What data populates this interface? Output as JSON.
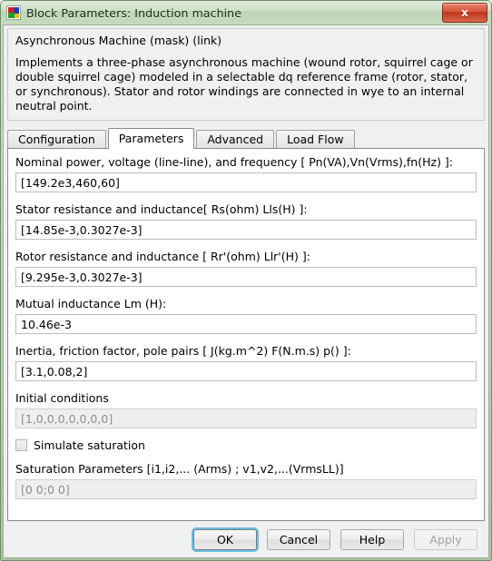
{
  "window": {
    "title": "Block Parameters: Induction machine",
    "icon": "simulink-block-icon",
    "close_label": "x",
    "frame_color": "#bcd4b4"
  },
  "description": {
    "heading": "Asynchronous Machine (mask) (link)",
    "body": "Implements a three-phase asynchronous machine (wound rotor, squirrel cage or double squirrel cage) modeled in a selectable dq reference frame (rotor, stator, or synchronous). Stator and rotor windings are connected in wye to an internal neutral point."
  },
  "tabs": [
    {
      "label": "Configuration",
      "active": false
    },
    {
      "label": "Parameters",
      "active": true
    },
    {
      "label": "Advanced",
      "active": false
    },
    {
      "label": "Load Flow",
      "active": false
    }
  ],
  "parameters": {
    "nominal": {
      "label": "Nominal power, voltage (line-line), and frequency [ Pn(VA),Vn(Vrms),fn(Hz) ]:",
      "value": "[149.2e3,460,60]"
    },
    "stator": {
      "label": "Stator resistance and inductance[ Rs(ohm)  Lls(H) ]:",
      "value": "[14.85e-3,0.3027e-3]"
    },
    "rotor": {
      "label": "Rotor resistance and inductance [ Rr'(ohm)  Llr'(H) ]:",
      "value": "[9.295e-3,0.3027e-3]"
    },
    "mutual": {
      "label": "Mutual inductance Lm (H):",
      "value": "10.46e-3"
    },
    "inertia": {
      "label": "Inertia, friction factor, pole pairs [ J(kg.m^2)  F(N.m.s)   p() ]:",
      "value": "[3.1,0.08,2]"
    },
    "initial_conditions": {
      "label": "Initial conditions",
      "value": "[1,0,0,0,0,0,0,0]",
      "disabled": true
    },
    "simulate_saturation": {
      "label": "Simulate saturation",
      "checked": false,
      "disabled": true
    },
    "saturation_parameters": {
      "label": "Saturation Parameters [i1,i2,... (Arms) ; v1,v2,...(VrmsLL)]",
      "value": "[0 0;0 0]",
      "disabled": true
    }
  },
  "footer": {
    "ok": "OK",
    "cancel": "Cancel",
    "help": "Help",
    "apply": "Apply"
  }
}
